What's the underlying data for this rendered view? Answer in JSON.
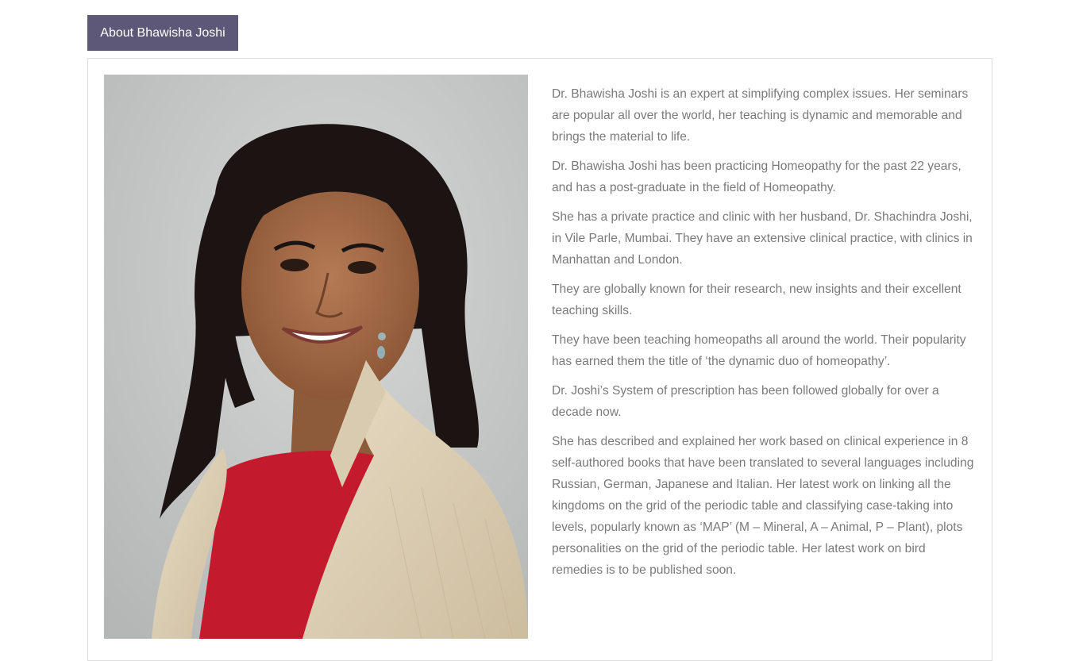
{
  "tab": {
    "label": "About Bhawisha Joshi"
  },
  "photo": {
    "alt": "Portrait of Dr. Bhawisha Joshi"
  },
  "bio": {
    "paragraphs": [
      "Dr. Bhawisha Joshi is an expert at simplifying complex issues. Her seminars are popular all over the world, her teaching is dynamic and memorable and brings the material to life.",
      "Dr. Bhawisha Joshi has been practicing Homeopathy for the past 22 years, and has a post-graduate in the field of Homeopathy.",
      "She has a private practice and clinic with her husband, Dr. Shachindra Joshi, in Vile Parle, Mumbai. They have an extensive clinical practice, with clinics in Manhattan and London.",
      "They are globally known for their research, new insights and their excellent teaching skills.",
      "They have been teaching homeopaths all around the world. Their popularity has earned them the title of ‘the dynamic duo of homeopathy’.",
      "Dr. Joshi’s System of prescription has been followed globally for over a decade now.",
      "She has described and explained her work based on clinical experience in 8 self-authored books that have been translated to several languages including Russian, German, Japanese and Italian. Her latest work on linking all the kingdoms on the grid of the periodic table and classifying case-taking into levels, popularly known as ‘MAP’ (M – Mineral, A – Animal, P – Plant), plots personalities on the grid of the periodic table. Her latest work on bird remedies is to be published soon."
    ]
  },
  "colors": {
    "tab_background": "#5e5878",
    "body_text": "#7a7a7a",
    "panel_border": "#dedede"
  }
}
